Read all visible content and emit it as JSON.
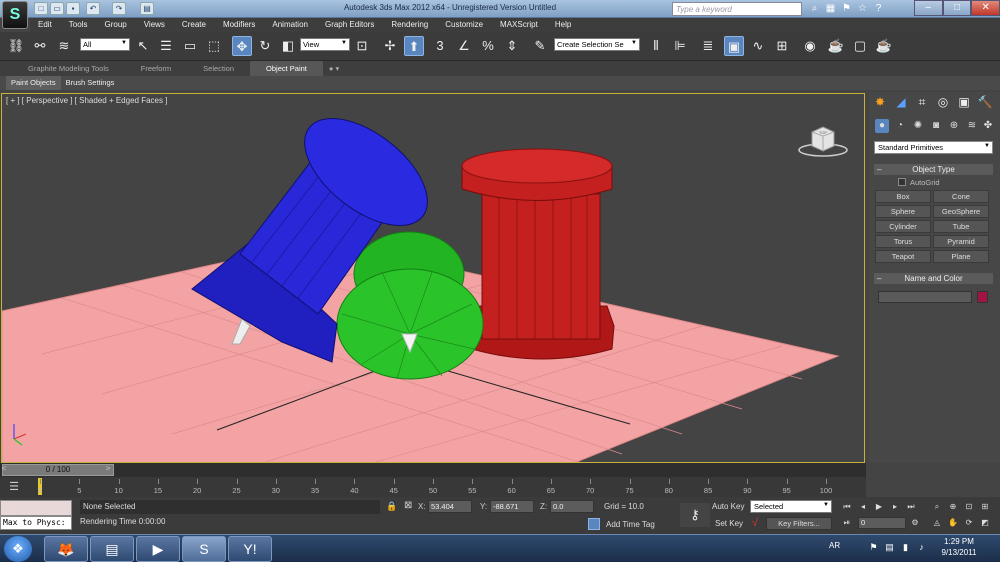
{
  "title": "Autodesk 3ds Max  2012 x64    -  Unregistered Version    Untitled",
  "search_placeholder": "Type a keyword",
  "menu": [
    "Edit",
    "Tools",
    "Group",
    "Views",
    "Create",
    "Modifiers",
    "Animation",
    "Graph Editors",
    "Rendering",
    "Customize",
    "MAXScript",
    "Help"
  ],
  "toolbar": {
    "selection_filter": "All",
    "ref_coord": "View",
    "snap_labels": [
      "3",
      "%"
    ],
    "named_selection": "Create Selection Se"
  },
  "ribbon_tabs": [
    "Graphite Modeling Tools",
    "Freeform",
    "Selection",
    "Object Paint"
  ],
  "sub_tabs": [
    "Paint Objects",
    "Brush Settings"
  ],
  "viewport_label": "[ + ] [ Perspective ] [ Shaded + Edged Faces ]",
  "viewcube_label": "TOP",
  "command_panel": {
    "category": "Standard Primitives",
    "object_type_header": "Object Type",
    "autogrid": "AutoGrid",
    "buttons": [
      "Box",
      "Cone",
      "Sphere",
      "GeoSphere",
      "Cylinder",
      "Tube",
      "Torus",
      "Pyramid",
      "Teapot",
      "Plane"
    ],
    "name_color_header": "Name and Color",
    "object_color": "#a01544"
  },
  "timeslider": {
    "label": "0 / 100"
  },
  "track_ticks": [
    "0",
    "5",
    "10",
    "15",
    "20",
    "25",
    "30",
    "35",
    "40",
    "45",
    "50",
    "55",
    "60",
    "65",
    "70",
    "75",
    "80",
    "85",
    "90",
    "95",
    "100"
  ],
  "status": {
    "maxscript_line": "Max to Physc:",
    "selection": "None Selected",
    "render_time": "Rendering Time  0:00:00",
    "x_label": "X:",
    "x_value": "53.404",
    "y_label": "Y:",
    "y_value": "-88.671",
    "z_label": "Z:",
    "z_value": "0.0",
    "grid": "Grid = 10.0",
    "add_time_tag": "Add Time Tag",
    "auto_key": "Auto Key",
    "set_key": "Set Key",
    "key_mode": "Selected",
    "key_filters": "Key Filters...",
    "current_frame": "0"
  },
  "taskbar": {
    "lang": "AR",
    "time": "1:29 PM",
    "date": "9/13/2011"
  },
  "colors": {
    "viewport_border": "#c9b23a",
    "active_tool": "#5a86c0",
    "plane": "#f3a3a3"
  }
}
